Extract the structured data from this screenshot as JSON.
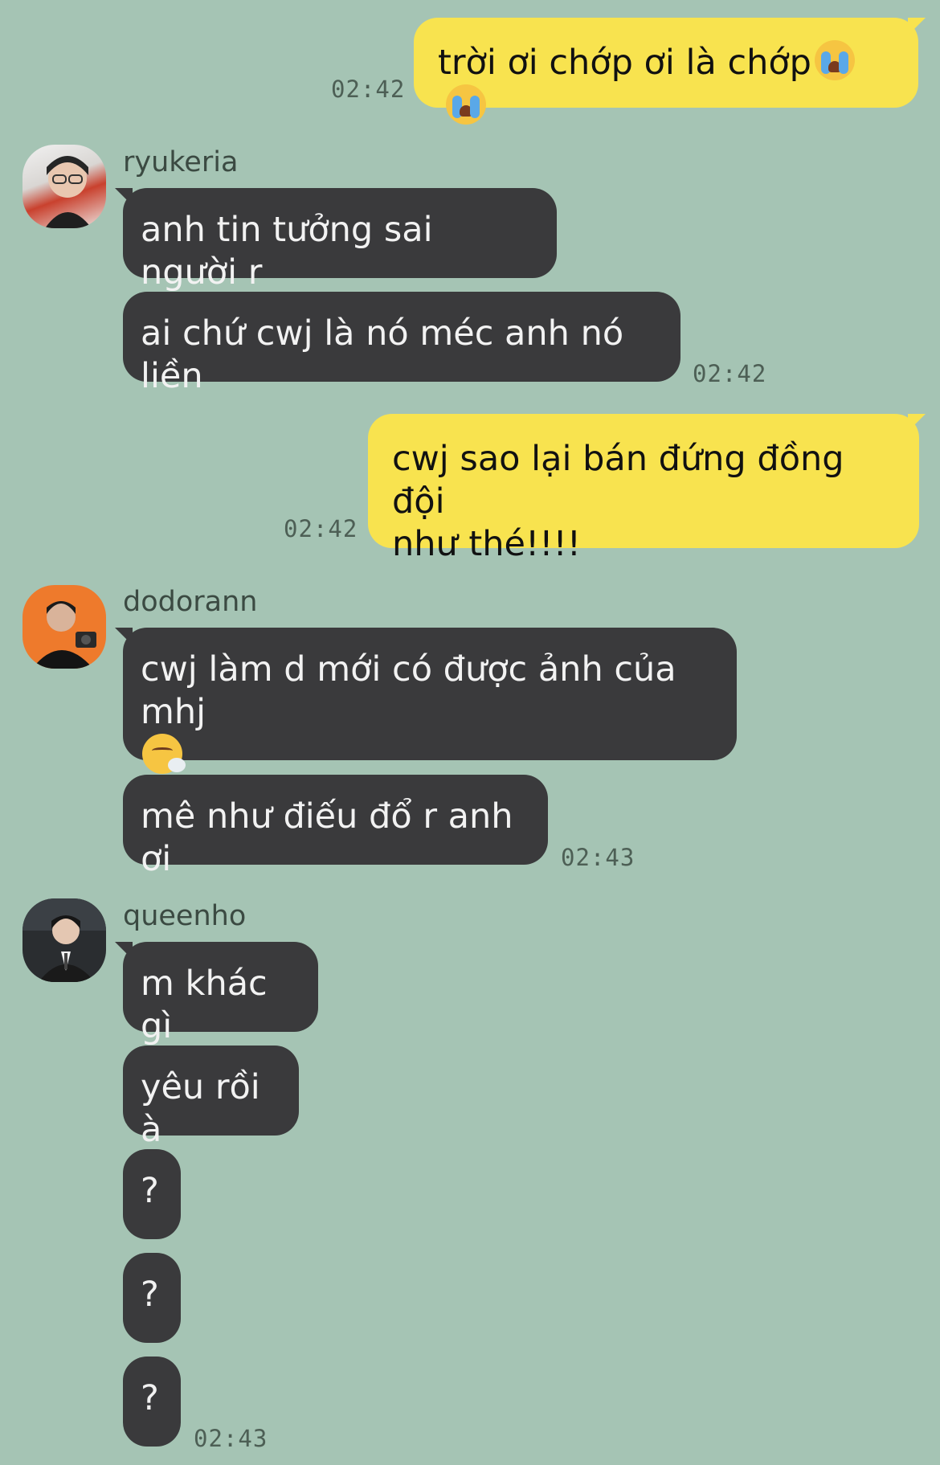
{
  "messages": [
    {
      "id": "m1",
      "side": "me",
      "text": "trời ơi chớp ơi là chớp",
      "emoji": [
        "loudly-crying-face",
        "loudly-crying-face"
      ],
      "time": "02:42"
    },
    {
      "id": "g1",
      "sender": "ryukeria",
      "items": [
        {
          "text": "anh tin tưởng sai người r"
        },
        {
          "text": "ai chứ cwj là nó méc anh nó liền",
          "time": "02:42"
        }
      ]
    },
    {
      "id": "m2",
      "side": "me",
      "lines": [
        "cwj sao lại bán đứng đồng đội",
        "như thé!!!!"
      ],
      "time": "02:42"
    },
    {
      "id": "g2",
      "sender": "dodorann",
      "items": [
        {
          "text": "cwj làm d mới có được ảnh của mhj",
          "emoji": "face-exhaling"
        },
        {
          "text": "mê như điếu đổ r anh ơi",
          "time": "02:43"
        }
      ]
    },
    {
      "id": "g3",
      "sender": "queenho",
      "items": [
        {
          "text": "m khác gì"
        },
        {
          "text": "yêu rồi à"
        },
        {
          "text": "?"
        },
        {
          "text": "?"
        },
        {
          "text": "?",
          "time": "02:43"
        }
      ]
    }
  ],
  "colors": {
    "background": "#a5c4b4",
    "my_bubble": "#f8e34f",
    "other_bubble": "#3a3a3c"
  }
}
